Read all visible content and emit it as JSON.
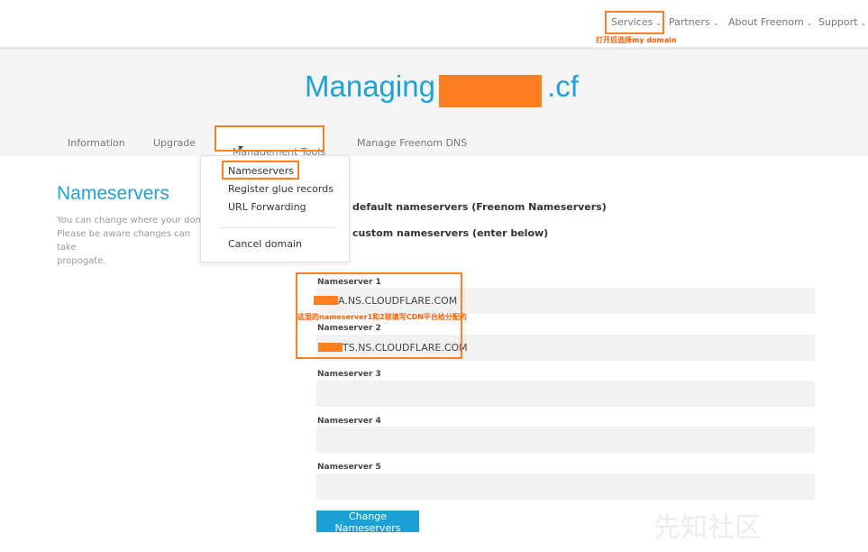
{
  "topnav": {
    "services": "Services",
    "partners": "Partners",
    "about": "About Freenom",
    "support": "Support",
    "annotation": "打开后选择my domain"
  },
  "hero": {
    "title_prefix": "Managing",
    "title_suffix": ".cf"
  },
  "tabs": {
    "information": "Information",
    "upgrade": "Upgrade",
    "management_tools": "Management Tools",
    "manage_dns": "Manage Freenom DNS"
  },
  "dropdown": {
    "nameservers": "Nameservers",
    "glue": "Register glue records",
    "url_forwarding": "URL Forwarding",
    "cancel": "Cancel domain"
  },
  "section": {
    "title": "Nameservers",
    "desc_line1": "You can change where your doma",
    "desc_line2": "Please be aware changes can take",
    "desc_line3": "propogate."
  },
  "options": {
    "default": "default nameservers (Freenom Nameservers)",
    "custom": "custom nameservers (enter below)"
  },
  "nameservers": [
    {
      "label": "Nameserver 1",
      "value": "A.NS.CLOUDFLARE.COM"
    },
    {
      "label": "Nameserver 2",
      "value": "TS.NS.CLOUDFLARE.COM"
    },
    {
      "label": "Nameserver 3",
      "value": ""
    },
    {
      "label": "Nameserver 4",
      "value": ""
    },
    {
      "label": "Nameserver 5",
      "value": ""
    }
  ],
  "annotation_ns": "这里的nameserver1和2就填写CDN平台给分配的",
  "submit_label": "Change Nameservers",
  "watermark": "先知社区",
  "colors": {
    "accent": "#20a2d6",
    "highlight": "#ff7f20",
    "button": "#1ca0d6"
  }
}
